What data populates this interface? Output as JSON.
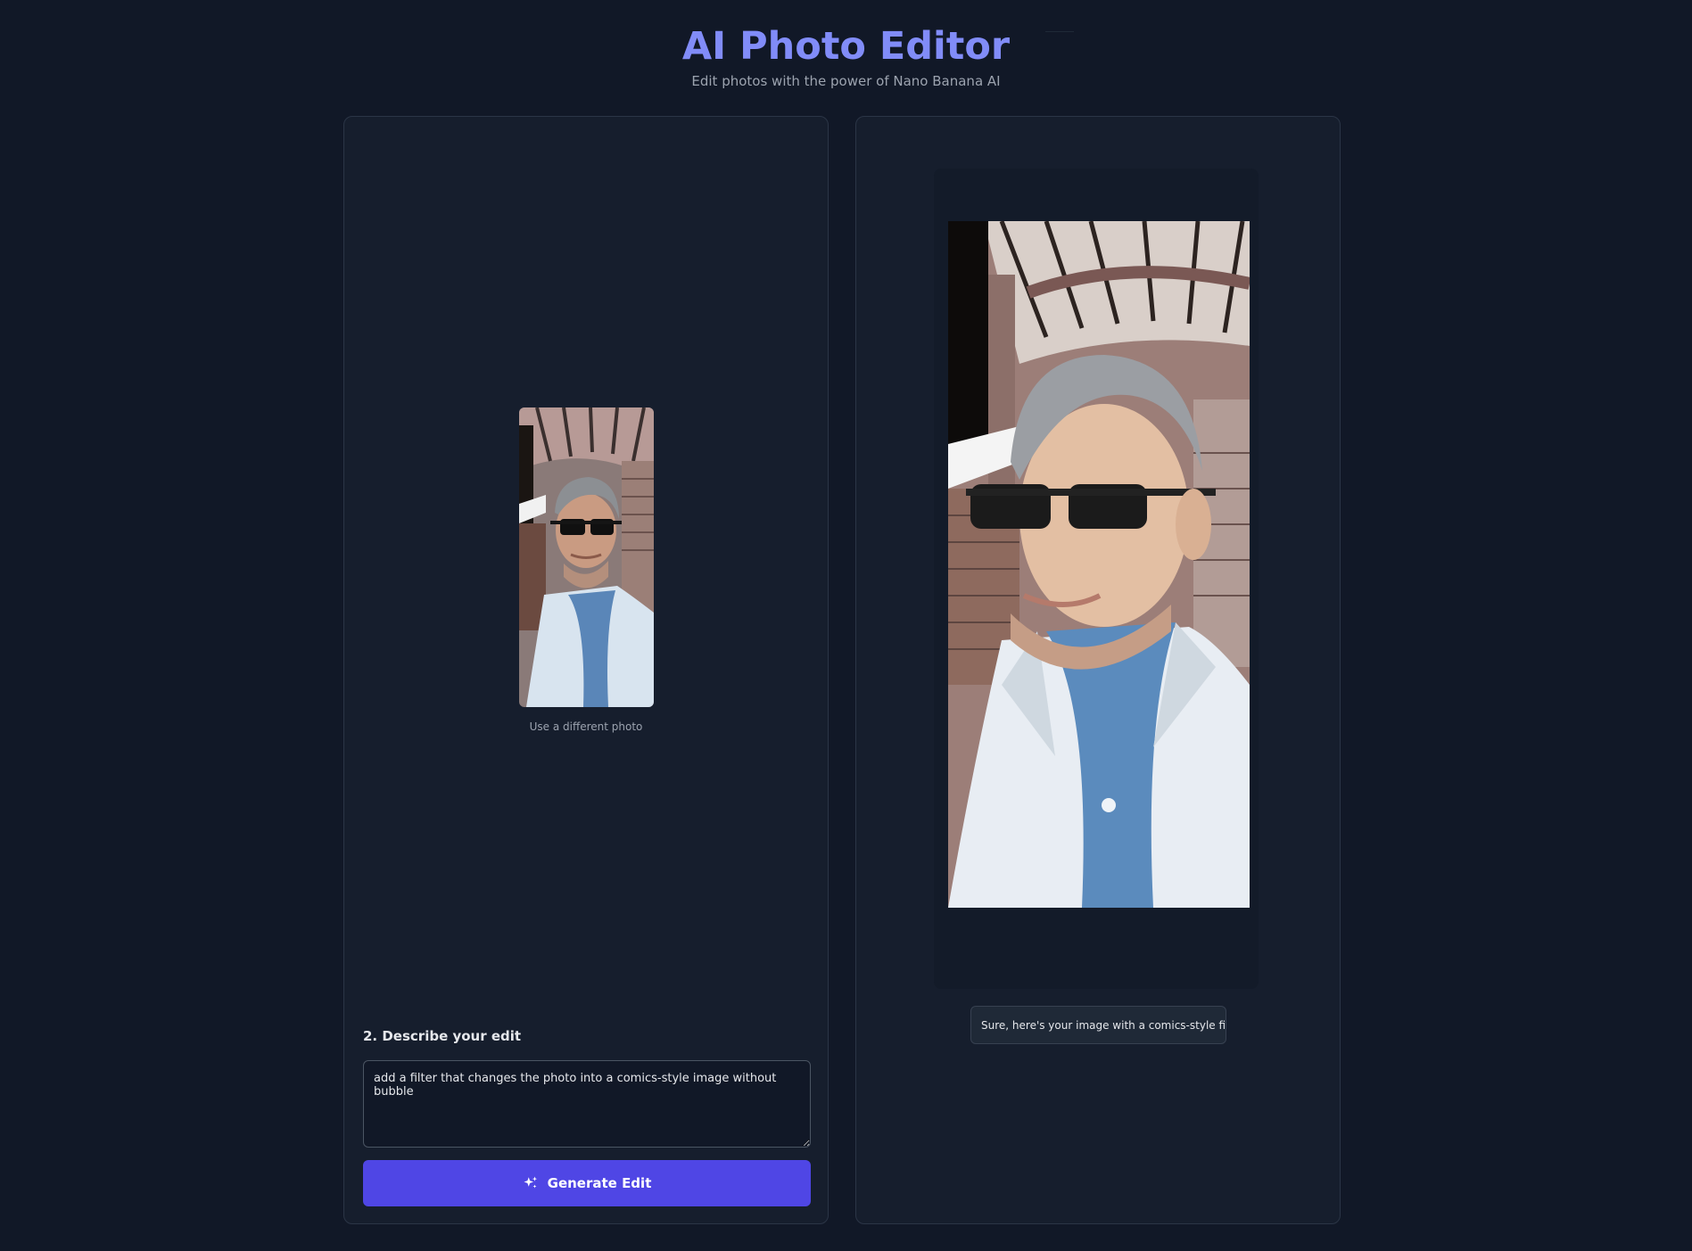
{
  "header": {
    "title": "AI Photo Editor",
    "subtitle": "Edit photos with the power of Nano Banana AI"
  },
  "editor": {
    "change_photo_label": "Use a different photo",
    "section_label": "2. Describe your edit",
    "prompt_value": "add a filter that changes the photo into a comics-style image without bubble",
    "generate_label": "Generate Edit",
    "generate_icon": "sparkles-icon"
  },
  "result": {
    "response_text": "Sure, here's your image with a comics-style filter:"
  },
  "colors": {
    "background": "#111827",
    "panel": "#161e2d",
    "accent": "#4f46e5",
    "title": "#818cf8"
  }
}
